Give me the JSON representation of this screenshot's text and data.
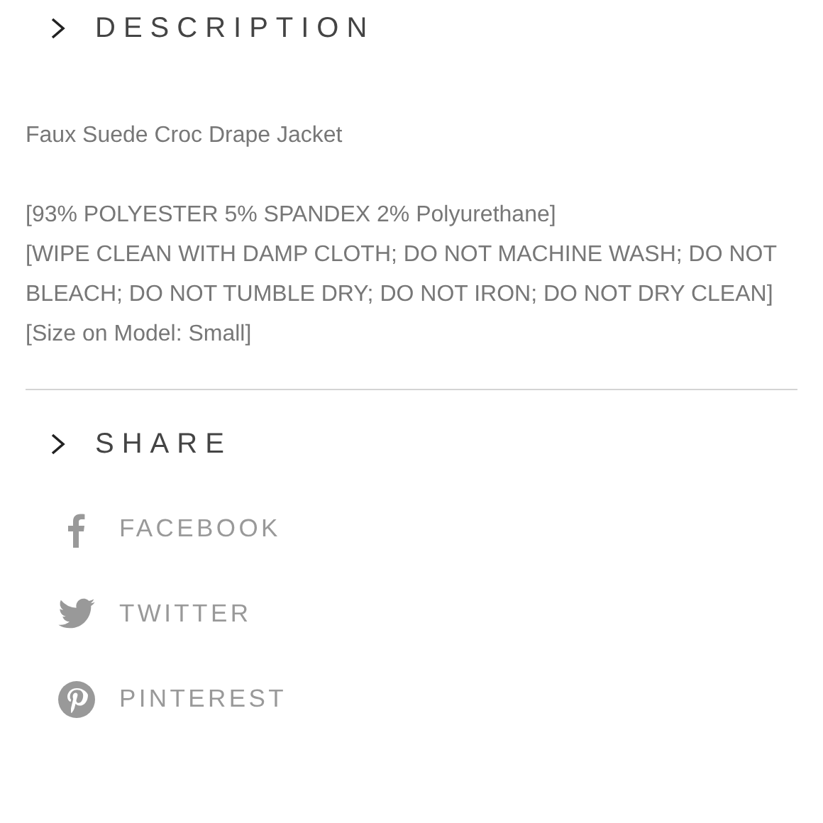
{
  "description": {
    "title": "DESCRIPTION",
    "expanded": false,
    "product_name": "Faux Suede Croc Drape Jacket",
    "details": [
      "[93% POLYESTER 5% SPANDEX 2% Polyurethane]",
      "[WIPE CLEAN WITH DAMP CLOTH; DO NOT MACHINE WASH; DO NOT BLEACH; DO NOT TUMBLE DRY; DO NOT IRON; DO NOT DRY CLEAN]",
      "[Size on Model: Small]"
    ]
  },
  "share": {
    "title": "SHARE",
    "expanded": false,
    "items": [
      {
        "kind": "facebook",
        "label": "FACEBOOK"
      },
      {
        "kind": "twitter",
        "label": "TWITTER"
      },
      {
        "kind": "pinterest",
        "label": "PINTEREST"
      }
    ]
  }
}
